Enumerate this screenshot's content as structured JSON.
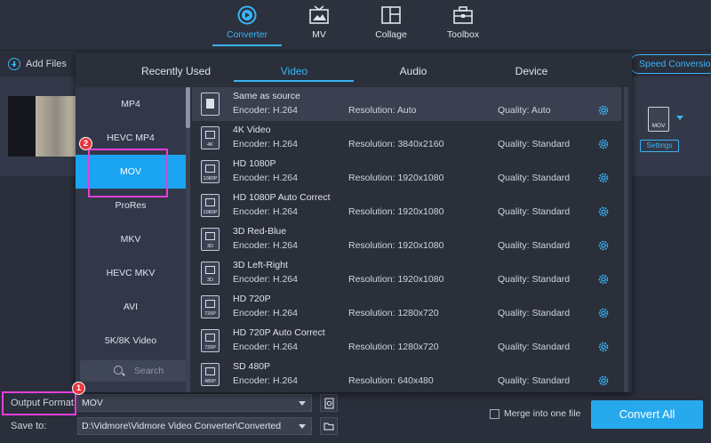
{
  "nav": {
    "tabs": [
      {
        "label": "Converter",
        "icon": "converter-icon",
        "active": true
      },
      {
        "label": "MV",
        "icon": "mv-icon"
      },
      {
        "label": "Collage",
        "icon": "collage-icon"
      },
      {
        "label": "Toolbox",
        "icon": "toolbox-icon"
      }
    ],
    "accent": "#3ab4f5"
  },
  "toolbar": {
    "add_files": "Add Files",
    "speed_conversion": "Speed Conversion"
  },
  "file_item": {
    "format_badge": "MOV",
    "settings_label": "Settings"
  },
  "popup": {
    "tabs": [
      "Recently Used",
      "Video",
      "Audio",
      "Device"
    ],
    "active_tab": "Video",
    "formats": [
      "MP4",
      "HEVC MP4",
      "MOV",
      "ProRes",
      "MKV",
      "HEVC MKV",
      "AVI",
      "5K/8K Video"
    ],
    "selected_format": "MOV",
    "search_placeholder": "Search",
    "presets": [
      {
        "name": "Same as source",
        "encoder": "Encoder: H.264",
        "resolution": "Resolution: Auto",
        "quality": "Quality: Auto",
        "badge": ""
      },
      {
        "name": "4K Video",
        "encoder": "Encoder: H.264",
        "resolution": "Resolution: 3840x2160",
        "quality": "Quality: Standard",
        "badge": "4K"
      },
      {
        "name": "HD 1080P",
        "encoder": "Encoder: H.264",
        "resolution": "Resolution: 1920x1080",
        "quality": "Quality: Standard",
        "badge": "1080P"
      },
      {
        "name": "HD 1080P Auto Correct",
        "encoder": "Encoder: H.264",
        "resolution": "Resolution: 1920x1080",
        "quality": "Quality: Standard",
        "badge": "1080P"
      },
      {
        "name": "3D Red-Blue",
        "encoder": "Encoder: H.264",
        "resolution": "Resolution: 1920x1080",
        "quality": "Quality: Standard",
        "badge": "3D"
      },
      {
        "name": "3D Left-Right",
        "encoder": "Encoder: H.264",
        "resolution": "Resolution: 1920x1080",
        "quality": "Quality: Standard",
        "badge": "3D"
      },
      {
        "name": "HD 720P",
        "encoder": "Encoder: H.264",
        "resolution": "Resolution: 1280x720",
        "quality": "Quality: Standard",
        "badge": "720P"
      },
      {
        "name": "HD 720P Auto Correct",
        "encoder": "Encoder: H.264",
        "resolution": "Resolution: 1280x720",
        "quality": "Quality: Standard",
        "badge": "720P"
      },
      {
        "name": "SD 480P",
        "encoder": "Encoder: H.264",
        "resolution": "Resolution: 640x480",
        "quality": "Quality: Standard",
        "badge": "480P"
      }
    ]
  },
  "bottom": {
    "output_format_label": "Output Format:",
    "output_format_value": "MOV",
    "save_to_label": "Save to:",
    "save_to_value": "D:\\Vidmore\\Vidmore Video Converter\\Converted",
    "merge_label": "Merge into one file",
    "convert_all": "Convert All"
  },
  "annotations": {
    "badge_1": "1",
    "badge_2": "2",
    "highlight_color": "#e63ddb"
  }
}
